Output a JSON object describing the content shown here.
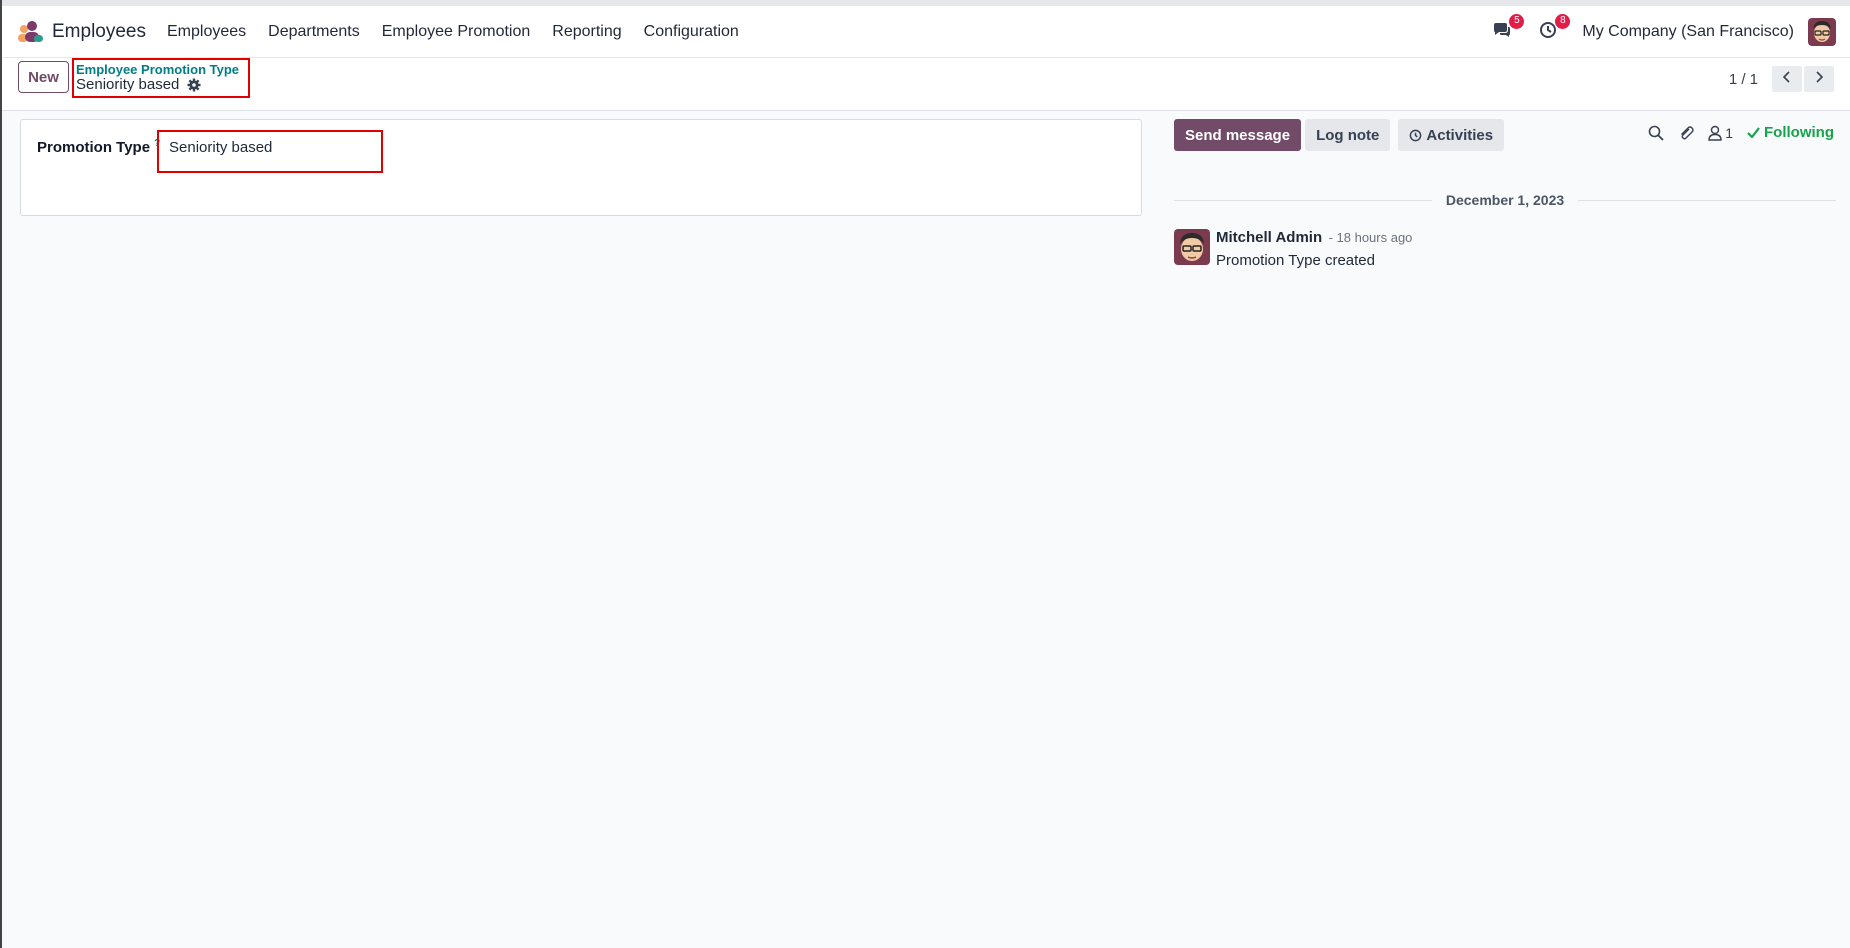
{
  "app": {
    "name": "Employees"
  },
  "menu": [
    "Employees",
    "Departments",
    "Employee Promotion",
    "Reporting",
    "Configuration"
  ],
  "systray": {
    "messages_badge": "5",
    "activities_badge": "8",
    "company": "My Company (San Francisco)"
  },
  "control_panel": {
    "new_label": "New",
    "breadcrumb_parent": "Employee Promotion Type",
    "breadcrumb_current": "Seniority based",
    "pager_value": "1 / 1"
  },
  "form": {
    "field_label": "Promotion Type",
    "help_mark": "?",
    "field_value": "Seniority based"
  },
  "chatter": {
    "send_message": "Send message",
    "log_note": "Log note",
    "activities": "Activities",
    "followers_count": "1",
    "following": "Following",
    "date_separator": "December 1, 2023",
    "message": {
      "author": "Mitchell Admin",
      "date": "- 18 hours ago",
      "body": "Promotion Type created"
    }
  },
  "colors": {
    "brand": "#714b67",
    "link": "#017e84",
    "highlight_border": "#e00000",
    "following": "#16a34a"
  },
  "icons": [
    "employees-app-icon",
    "chat-icon",
    "clock-icon",
    "gear-icon",
    "chevron-left-icon",
    "chevron-right-icon",
    "search-icon",
    "paperclip-icon",
    "user-icon",
    "check-icon"
  ]
}
